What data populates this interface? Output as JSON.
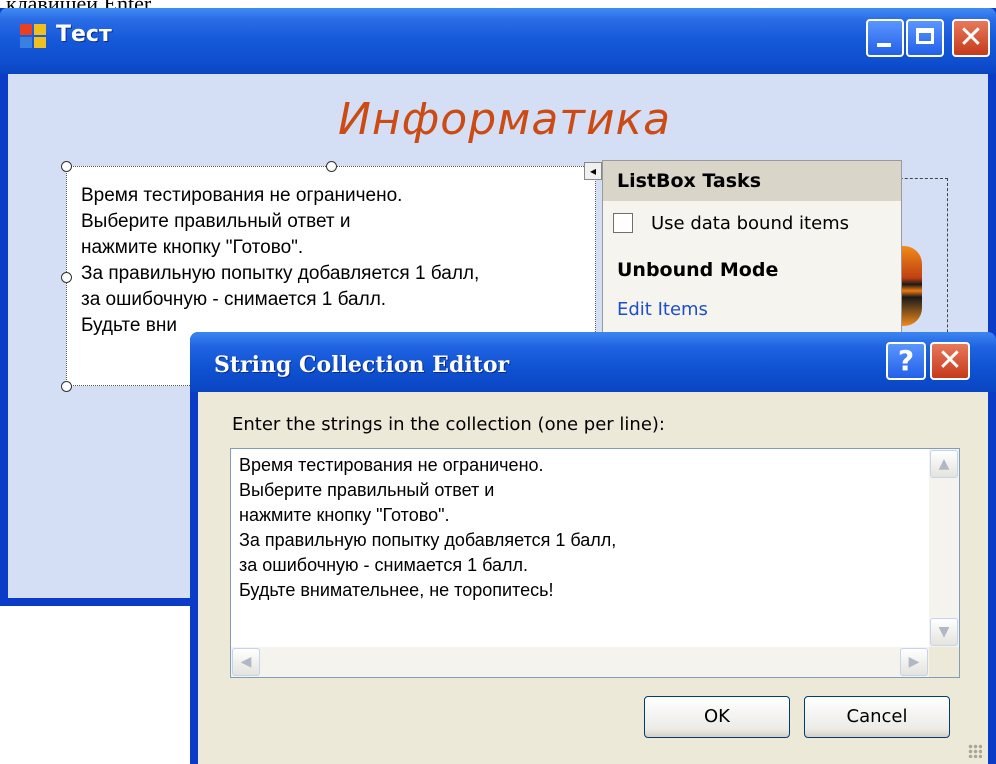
{
  "document": {
    "top_text": "клавишей Enter."
  },
  "main_window": {
    "title": "Тест",
    "heading": "Информатика",
    "listbox_lines": [
      "Время тестирования не ограничено.",
      "Выберите правильный ответ и",
      "нажмите кнопку \"Готово\".",
      "За правильную попытку добавляется 1 балл,",
      "за ошибочную - снимается 1 балл.",
      "Будьте вни"
    ]
  },
  "tasks_panel": {
    "header": "ListBox Tasks",
    "checkbox_label": "Use data bound items",
    "section": "Unbound Mode",
    "link": "Edit Items"
  },
  "dialog": {
    "title": "String Collection Editor",
    "help_glyph": "?",
    "close_glyph": "✕",
    "prompt": "Enter the strings in the collection (one per line):",
    "lines": [
      "Время тестирования не ограничено.",
      "Выберите правильный ответ и",
      "нажмите кнопку \"Готово\".",
      "За правильную попытку добавляется 1 балл,",
      "за ошибочную - снимается 1 балл.",
      "Будьте внимательнее, не торопитесь!"
    ],
    "ok_label": "OK",
    "cancel_label": "Cancel"
  },
  "colors": {
    "heading": "#cc4a14",
    "titlebar": "#1558d8",
    "client": "#d4def4",
    "link": "#1d50c8"
  }
}
